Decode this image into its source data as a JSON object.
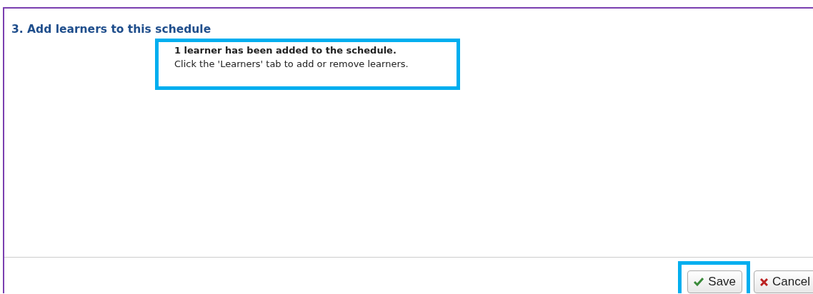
{
  "section": {
    "title": "3. Add learners to this schedule"
  },
  "notice": {
    "headline": "1 learner has been added to the schedule.",
    "detail": "Click the 'Learners' tab to add or remove learners.",
    "highlighted": true
  },
  "buttons": [
    {
      "kind": "save",
      "label": "Save",
      "highlighted": true
    },
    {
      "kind": "cancel",
      "label": "Cancel",
      "highlighted": false
    }
  ]
}
